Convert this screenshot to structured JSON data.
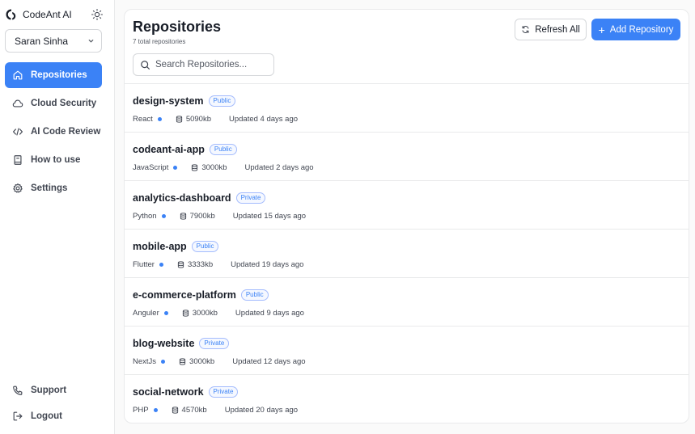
{
  "brand": {
    "name": "CodeAnt AI"
  },
  "user": {
    "name": "Saran Sinha"
  },
  "nav": [
    {
      "label": "Repositories",
      "icon": "home-icon",
      "active": true
    },
    {
      "label": "Cloud Security",
      "icon": "cloud-icon",
      "active": false
    },
    {
      "label": "AI Code Review",
      "icon": "code-icon",
      "active": false
    },
    {
      "label": "How to use",
      "icon": "book-icon",
      "active": false
    },
    {
      "label": "Settings",
      "icon": "gear-icon",
      "active": false
    }
  ],
  "bottom_nav": [
    {
      "label": "Support",
      "icon": "phone-icon"
    },
    {
      "label": "Logout",
      "icon": "logout-icon"
    }
  ],
  "header": {
    "title": "Repositories",
    "subtitle": "7 total repositories",
    "refresh_label": "Refresh All",
    "add_label": "Add Repository",
    "search_placeholder": "Search Repositories..."
  },
  "repositories": [
    {
      "name": "design-system",
      "visibility": "Public",
      "language": "React",
      "size": "5090kb",
      "updated": "Updated 4 days ago"
    },
    {
      "name": "codeant-ai-app",
      "visibility": "Public",
      "language": "JavaScript",
      "size": "3000kb",
      "updated": "Updated 2 days ago"
    },
    {
      "name": "analytics-dashboard",
      "visibility": "Private",
      "language": "Python",
      "size": "7900kb",
      "updated": "Updated 15 days ago"
    },
    {
      "name": "mobile-app",
      "visibility": "Public",
      "language": "Flutter",
      "size": "3333kb",
      "updated": "Updated 19 days ago"
    },
    {
      "name": "e-commerce-platform",
      "visibility": "Public",
      "language": "Anguler",
      "size": "3000kb",
      "updated": "Updated 9 days ago"
    },
    {
      "name": "blog-website",
      "visibility": "Private",
      "language": "NextJs",
      "size": "3000kb",
      "updated": "Updated 12 days ago"
    },
    {
      "name": "social-network",
      "visibility": "Private",
      "language": "PHP",
      "size": "4570kb",
      "updated": "Updated 20 days ago"
    }
  ],
  "colors": {
    "accent": "#3b82f6",
    "text": "#181d27",
    "border": "#e9eaeb"
  }
}
